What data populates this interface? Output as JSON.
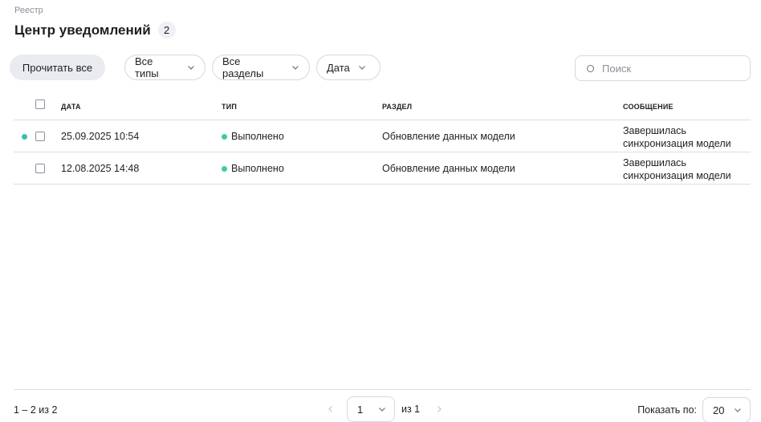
{
  "breadcrumb": "Реестр",
  "header": {
    "title": "Центр уведомлений",
    "count": "2"
  },
  "toolbar": {
    "read_all_label": "Прочитать все",
    "filters": {
      "types": "Все типы",
      "sections": "Все разделы",
      "date": "Дата"
    },
    "search_placeholder": "Поиск",
    "search_value": ""
  },
  "table": {
    "columns": {
      "date": "ДАТА",
      "type": "ТИП",
      "section": "РАЗДЕЛ",
      "message": "СООБЩЕНИЕ"
    },
    "rows": [
      {
        "unread": true,
        "date": "25.09.2025 10:54",
        "type": "Выполнено",
        "section": "Обновление данных модели",
        "message_line1": "Завершилась",
        "message_line2": "синхронизация модели"
      },
      {
        "unread": false,
        "date": "12.08.2025 14:48",
        "type": "Выполнено",
        "section": "Обновление данных модели",
        "message_line1": "Завершилась",
        "message_line2": "синхронизация модели"
      }
    ]
  },
  "footer": {
    "range": "1 – 2 из 2",
    "page": "1",
    "of_pages": "из 1",
    "per_page_label": "Показать по:",
    "per_page": "20"
  },
  "colors": {
    "unread_dot": "#3bbdb1",
    "status_done": "#3ecf8e",
    "button_bg": "#e9ebf0"
  },
  "icons": [
    "chevron-down-icon",
    "search-icon",
    "chevron-left-icon",
    "chevron-right-icon",
    "checkbox-icon"
  ]
}
